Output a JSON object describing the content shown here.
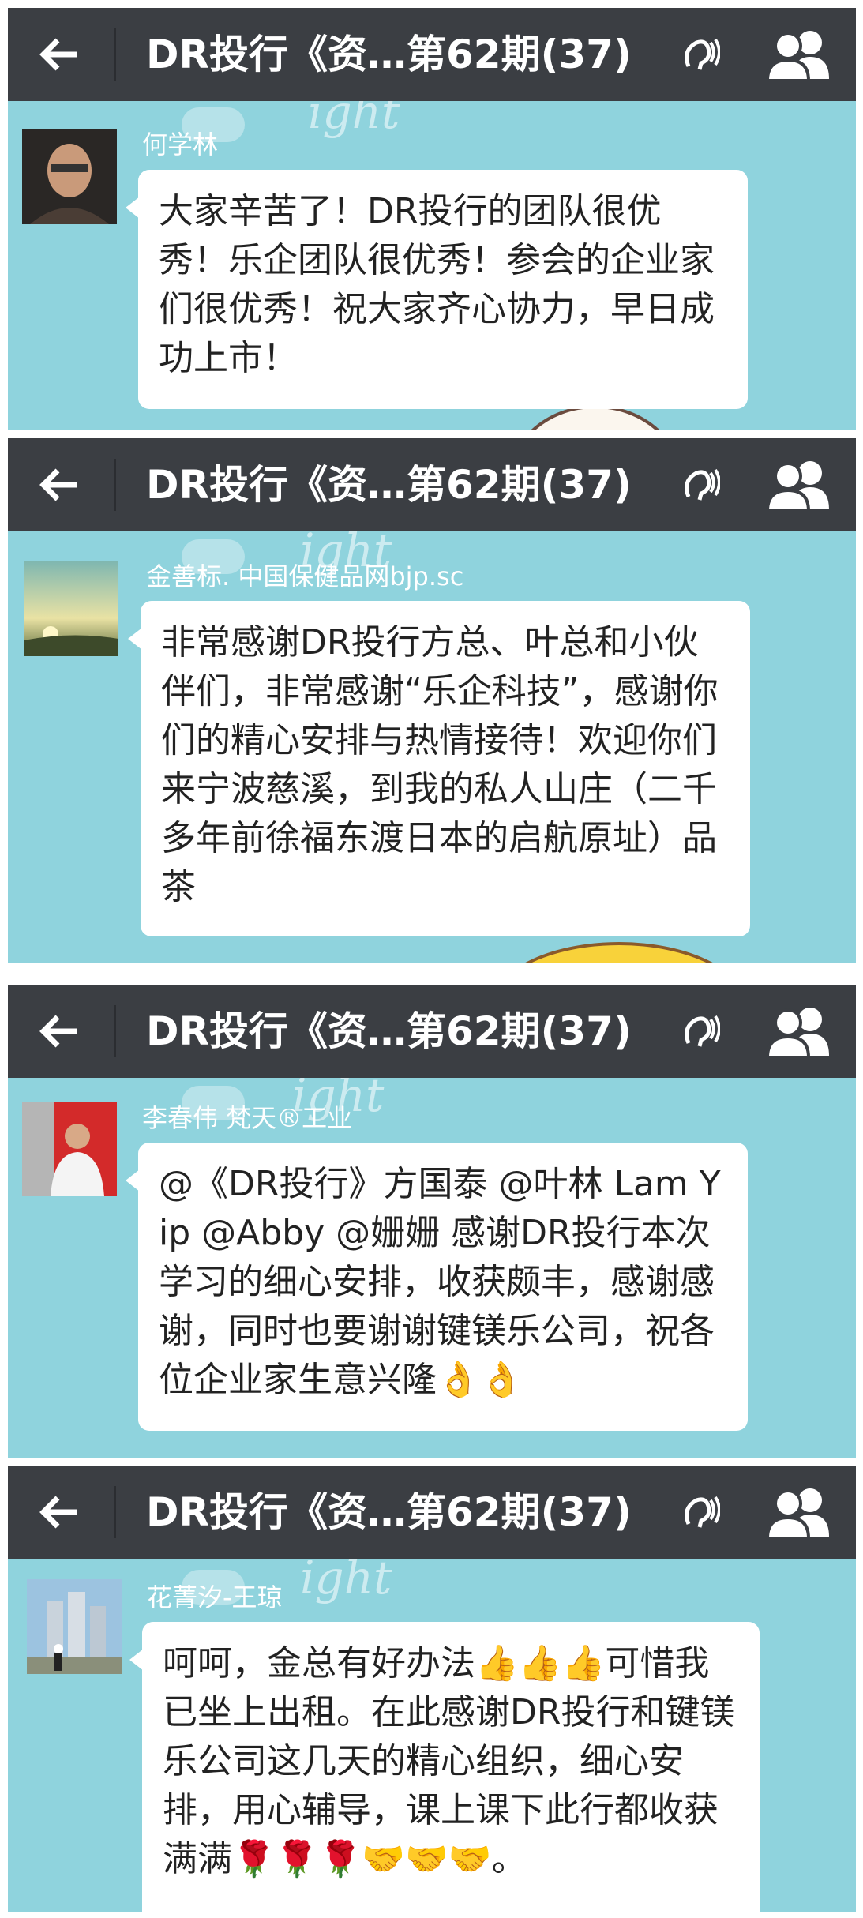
{
  "screens": [
    {
      "title": "DR投行《资…第62期(37)",
      "sender": "何学林",
      "message": "大家辛苦了！DR投行的团队很优秀！乐企团队很优秀！参会的企业家们很优秀！祝大家齐心协力，早日成功上市！"
    },
    {
      "title": "DR投行《资…第62期(37)",
      "sender": "金善标. 中国保健品网bjp.sc",
      "message": "非常感谢DR投行方总、叶总和小伙伴们，非常感谢“乐企科技”，感谢你们的精心安排与热情接待！欢迎你们来宁波慈溪，到我的私人山庄（二千多年前徐福东渡日本的启航原址）品茶"
    },
    {
      "title": "DR投行《资…第62期(37)",
      "sender": "李春伟 梵天®工业",
      "message": "@《DR投行》方国泰 @叶林 Lam Yip @Abby @姗姗 感谢DR投行本次学习的细心安排，收获颇丰，感谢感谢，同时也要谢谢键镁乐公司，祝各位企业家生意兴隆👌👌"
    },
    {
      "title": "DR投行《资…第62期(37)",
      "sender": "花菁汐-王琼",
      "message": "呵呵，金总有好办法👍👍👍可惜我已坐上出租。在此感谢DR投行和键镁乐公司这几天的精心组织，细心安排，用心辅导，课上课下此行都收获满满🌹🌹🌹🤝🤝🤝。"
    }
  ],
  "icons": {
    "back": "arrow-left-icon",
    "voice": "voice-mode-icon",
    "group": "group-members-icon"
  },
  "colors": {
    "header": "#3b3e43",
    "chat_background": "#8fd3dd",
    "bubble": "#ffffff"
  }
}
